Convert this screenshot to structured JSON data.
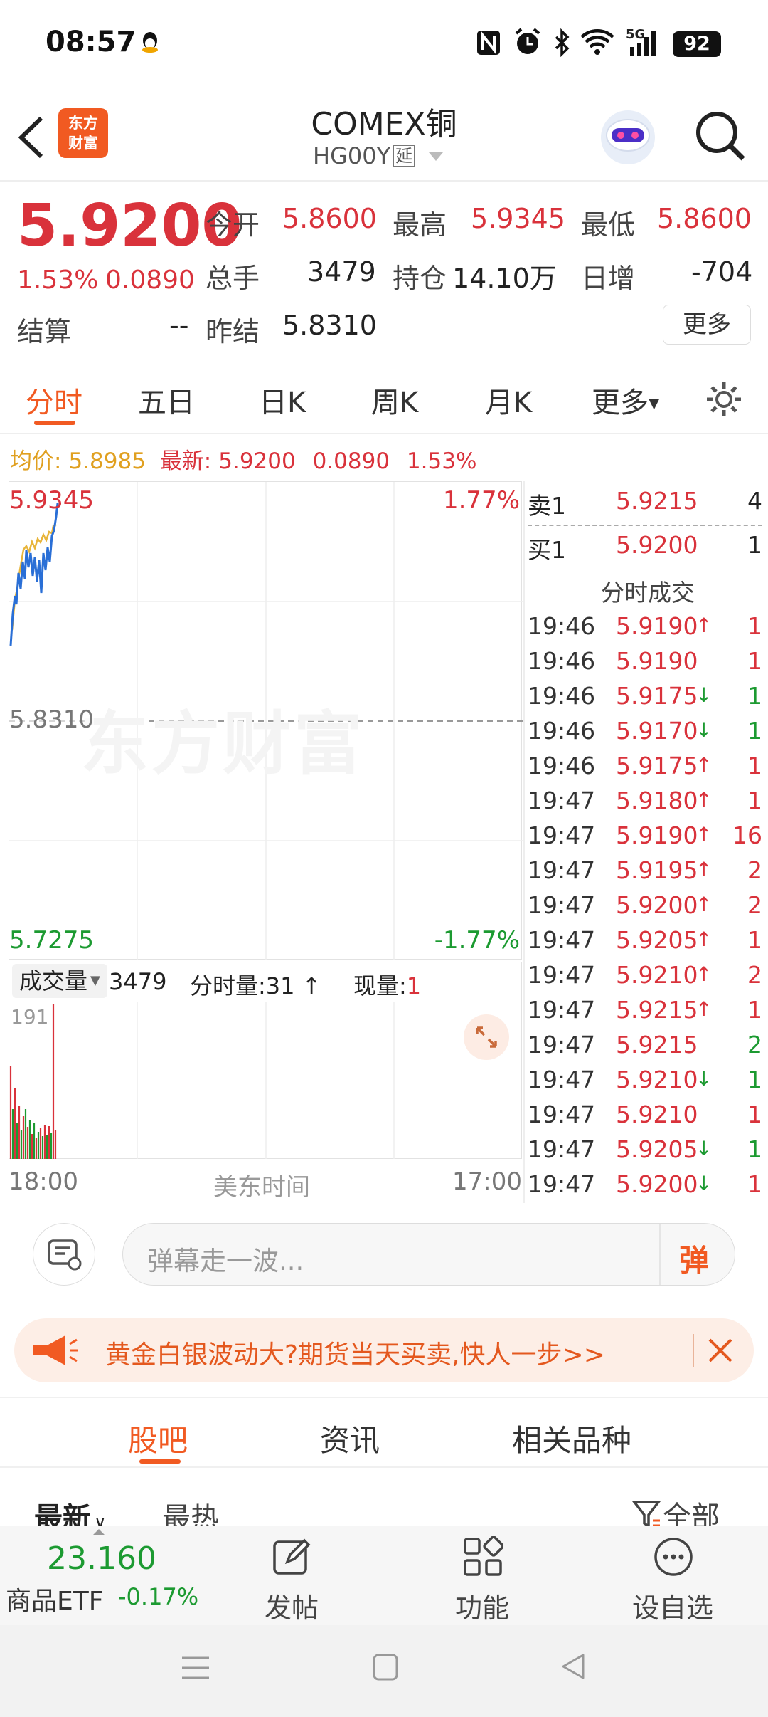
{
  "status": {
    "time": "08:57",
    "battery": "92",
    "network": "5G"
  },
  "header": {
    "logo_text_1": "东方",
    "logo_text_2": "财富",
    "title": "COMEX铜",
    "code": "HG00Y",
    "delay_badge": "延"
  },
  "quote": {
    "price": "5.9200",
    "change_pct": "1.53%",
    "change_abs": "0.0890",
    "fields": [
      {
        "label": "今开",
        "value": "5.8600"
      },
      {
        "label": "最高",
        "value": "5.9345"
      },
      {
        "label": "最低",
        "value": "5.8600"
      },
      {
        "label": "总手",
        "value": "3479"
      },
      {
        "label": "持仓",
        "value": "14.10万"
      },
      {
        "label": "日增",
        "value": "-704"
      },
      {
        "label": "结算",
        "value": "--"
      },
      {
        "label": "昨结",
        "value": "5.8310"
      }
    ],
    "more_button": "更多"
  },
  "tabs": [
    "分时",
    "五日",
    "日K",
    "周K",
    "月K",
    "更多"
  ],
  "active_tab": "分时",
  "info_line": {
    "avg_label": "均价:",
    "avg_value": "5.8985",
    "latest_label": "最新:",
    "latest_value": "5.9200",
    "change_abs": "0.0890",
    "change_pct": "1.53%"
  },
  "chart": {
    "high": "5.9345",
    "high_pct": "1.77%",
    "mid": "5.8310",
    "low": "5.7275",
    "low_pct": "-1.77%",
    "watermark": "东方财富",
    "time_start": "18:00",
    "time_label": "美东时间",
    "time_end": "17:00"
  },
  "volume_bar": {
    "selector": "成交量",
    "total": "3479",
    "minute_label": "分时量:",
    "minute_value": "31",
    "current_label": "现量:",
    "current_value": "1",
    "max_label": "191"
  },
  "orderbook": [
    {
      "side": "卖1",
      "price": "5.9215",
      "qty": "4"
    },
    {
      "side": "买1",
      "price": "5.9200",
      "qty": "1"
    }
  ],
  "trades_title": "分时成交",
  "trades": [
    {
      "time": "19:46",
      "price": "5.9190",
      "dir": "↑",
      "qty": "1",
      "qtycolor": "red"
    },
    {
      "time": "19:46",
      "price": "5.9190",
      "dir": "",
      "qty": "1",
      "qtycolor": "red"
    },
    {
      "time": "19:46",
      "price": "5.9175",
      "dir": "↓",
      "qty": "1",
      "qtycolor": "green"
    },
    {
      "time": "19:46",
      "price": "5.9170",
      "dir": "↓",
      "qty": "1",
      "qtycolor": "green"
    },
    {
      "time": "19:46",
      "price": "5.9175",
      "dir": "↑",
      "qty": "1",
      "qtycolor": "red"
    },
    {
      "time": "19:47",
      "price": "5.9180",
      "dir": "↑",
      "qty": "1",
      "qtycolor": "red"
    },
    {
      "time": "19:47",
      "price": "5.9190",
      "dir": "↑",
      "qty": "16",
      "qtycolor": "red"
    },
    {
      "time": "19:47",
      "price": "5.9195",
      "dir": "↑",
      "qty": "2",
      "qtycolor": "red"
    },
    {
      "time": "19:47",
      "price": "5.9200",
      "dir": "↑",
      "qty": "2",
      "qtycolor": "red"
    },
    {
      "time": "19:47",
      "price": "5.9205",
      "dir": "↑",
      "qty": "1",
      "qtycolor": "red"
    },
    {
      "time": "19:47",
      "price": "5.9210",
      "dir": "↑",
      "qty": "2",
      "qtycolor": "red"
    },
    {
      "time": "19:47",
      "price": "5.9215",
      "dir": "↑",
      "qty": "1",
      "qtycolor": "red"
    },
    {
      "time": "19:47",
      "price": "5.9215",
      "dir": "",
      "qty": "2",
      "qtycolor": "green"
    },
    {
      "time": "19:47",
      "price": "5.9210",
      "dir": "↓",
      "qty": "1",
      "qtycolor": "green"
    },
    {
      "time": "19:47",
      "price": "5.9210",
      "dir": "",
      "qty": "1",
      "qtycolor": "red"
    },
    {
      "time": "19:47",
      "price": "5.9205",
      "dir": "↓",
      "qty": "1",
      "qtycolor": "green"
    },
    {
      "time": "19:47",
      "price": "5.9200",
      "dir": "↓",
      "qty": "1",
      "qtycolor": "red"
    }
  ],
  "danmu": {
    "placeholder": "弹幕走一波...",
    "button": "弹"
  },
  "banner": {
    "text": "黄金白银波动大?期货当天买卖,快人一步>>"
  },
  "section_tabs": [
    "股吧",
    "资讯",
    "相关品种"
  ],
  "section_active": "股吧",
  "sort": {
    "latest": "最新",
    "hot": "最热",
    "filter": "全部"
  },
  "bottom_nav": {
    "etf_value": "23.160",
    "etf_name": "商品ETF",
    "etf_change": "-0.17%",
    "items": [
      "发帖",
      "功能",
      "设自选"
    ]
  },
  "colors": {
    "up": "#d9323b",
    "down": "#1c9a31",
    "brand": "#f15a22",
    "line": "#2a6fd6",
    "avg": "#e8b53b"
  }
}
